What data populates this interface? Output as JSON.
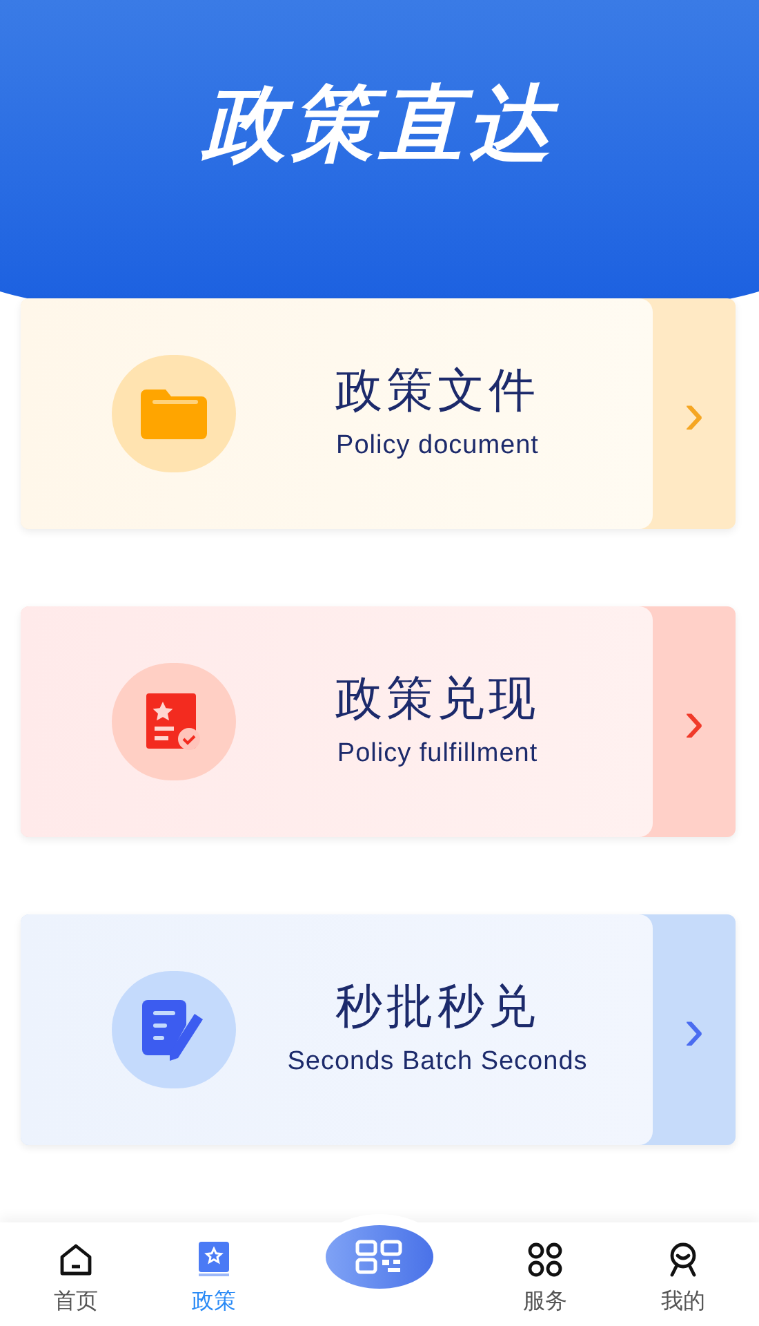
{
  "header": {
    "title": "政策直达"
  },
  "cards": [
    {
      "kind": "folder",
      "title": "政策文件",
      "subtitle": "Policy document",
      "chevron": "›"
    },
    {
      "kind": "certificate",
      "title": "政策兑现",
      "subtitle": "Policy fulfillment",
      "chevron": "›"
    },
    {
      "kind": "edit",
      "title": "秒批秒兑",
      "subtitle": "Seconds Batch Seconds",
      "chevron": "›"
    }
  ],
  "tab_bar": {
    "items": [
      {
        "kind": "home",
        "label": "首页",
        "selected": false
      },
      {
        "kind": "policy",
        "label": "政策",
        "selected": true
      },
      {
        "kind": "scan"
      },
      {
        "kind": "services",
        "label": "服务",
        "selected": false
      },
      {
        "kind": "profile",
        "label": "我的",
        "selected": false
      }
    ]
  }
}
